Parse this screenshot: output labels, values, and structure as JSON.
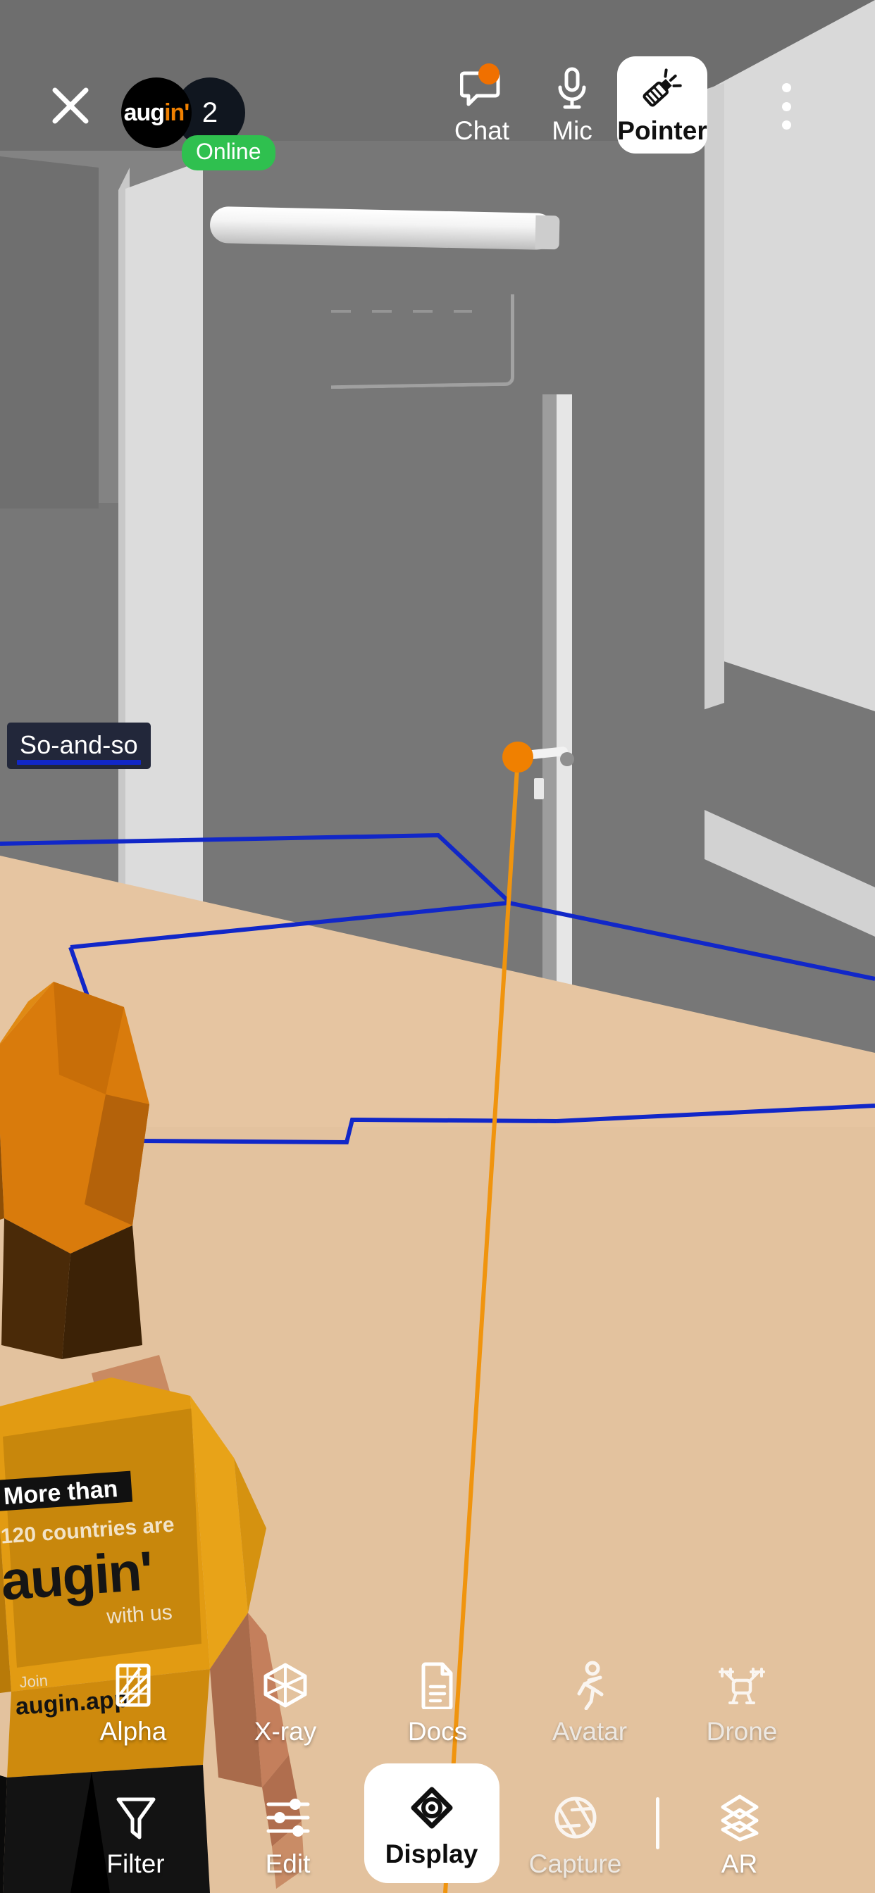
{
  "app": {
    "name": "augin",
    "brand_color": "#F08000",
    "online_color": "#2fc04f",
    "wireframe_color": "#1127c8"
  },
  "topbar": {
    "close_label": "Close",
    "close_icon": "close-icon",
    "presence": {
      "logo_prefix": "aug",
      "logo_mark": "in'",
      "participant_count": "2",
      "status_badge": "Online"
    },
    "tools": [
      {
        "label": "Chat",
        "icon": "chat-bubble-icon",
        "active": false,
        "badge": true
      },
      {
        "label": "Mic",
        "icon": "microphone-icon",
        "active": false,
        "badge": false
      },
      {
        "label": "Pointer",
        "icon": "laser-pointer-icon",
        "active": true,
        "badge": false
      }
    ],
    "overflow_icon": "more-vertical-icon",
    "overflow_label": "More options"
  },
  "scene": {
    "nametag": "So-and-so",
    "pointer_dot_color": "#F08000",
    "ray_color": "#F0940E",
    "avatar_shirt": {
      "line1": "More than",
      "line2": "120 countries are",
      "line3": "augin'",
      "line4": "with us",
      "line5": "Join",
      "line6": "augin.app"
    }
  },
  "bottombar": {
    "row1": [
      {
        "label": "Alpha",
        "icon": "alpha-hatch-icon",
        "active": false,
        "dim": false
      },
      {
        "label": "X-ray",
        "icon": "xray-cube-icon",
        "active": false,
        "dim": false
      },
      {
        "label": "Docs",
        "icon": "document-icon",
        "active": false,
        "dim": false
      },
      {
        "label": "Avatar",
        "icon": "running-person-icon",
        "active": false,
        "dim": true
      },
      {
        "label": "Drone",
        "icon": "drone-icon",
        "active": false,
        "dim": true
      }
    ],
    "row2": [
      {
        "label": "Filter",
        "icon": "funnel-icon",
        "active": false,
        "dim": false
      },
      {
        "label": "Edit",
        "icon": "sliders-icon",
        "active": false,
        "dim": false
      },
      {
        "label": "Display",
        "icon": "eye-icon",
        "active": true,
        "dim": false
      },
      {
        "label": "Capture",
        "icon": "aperture-icon",
        "active": false,
        "dim": true
      },
      {
        "label": "AR",
        "icon": "layers-icon",
        "active": false,
        "dim": false
      }
    ]
  }
}
